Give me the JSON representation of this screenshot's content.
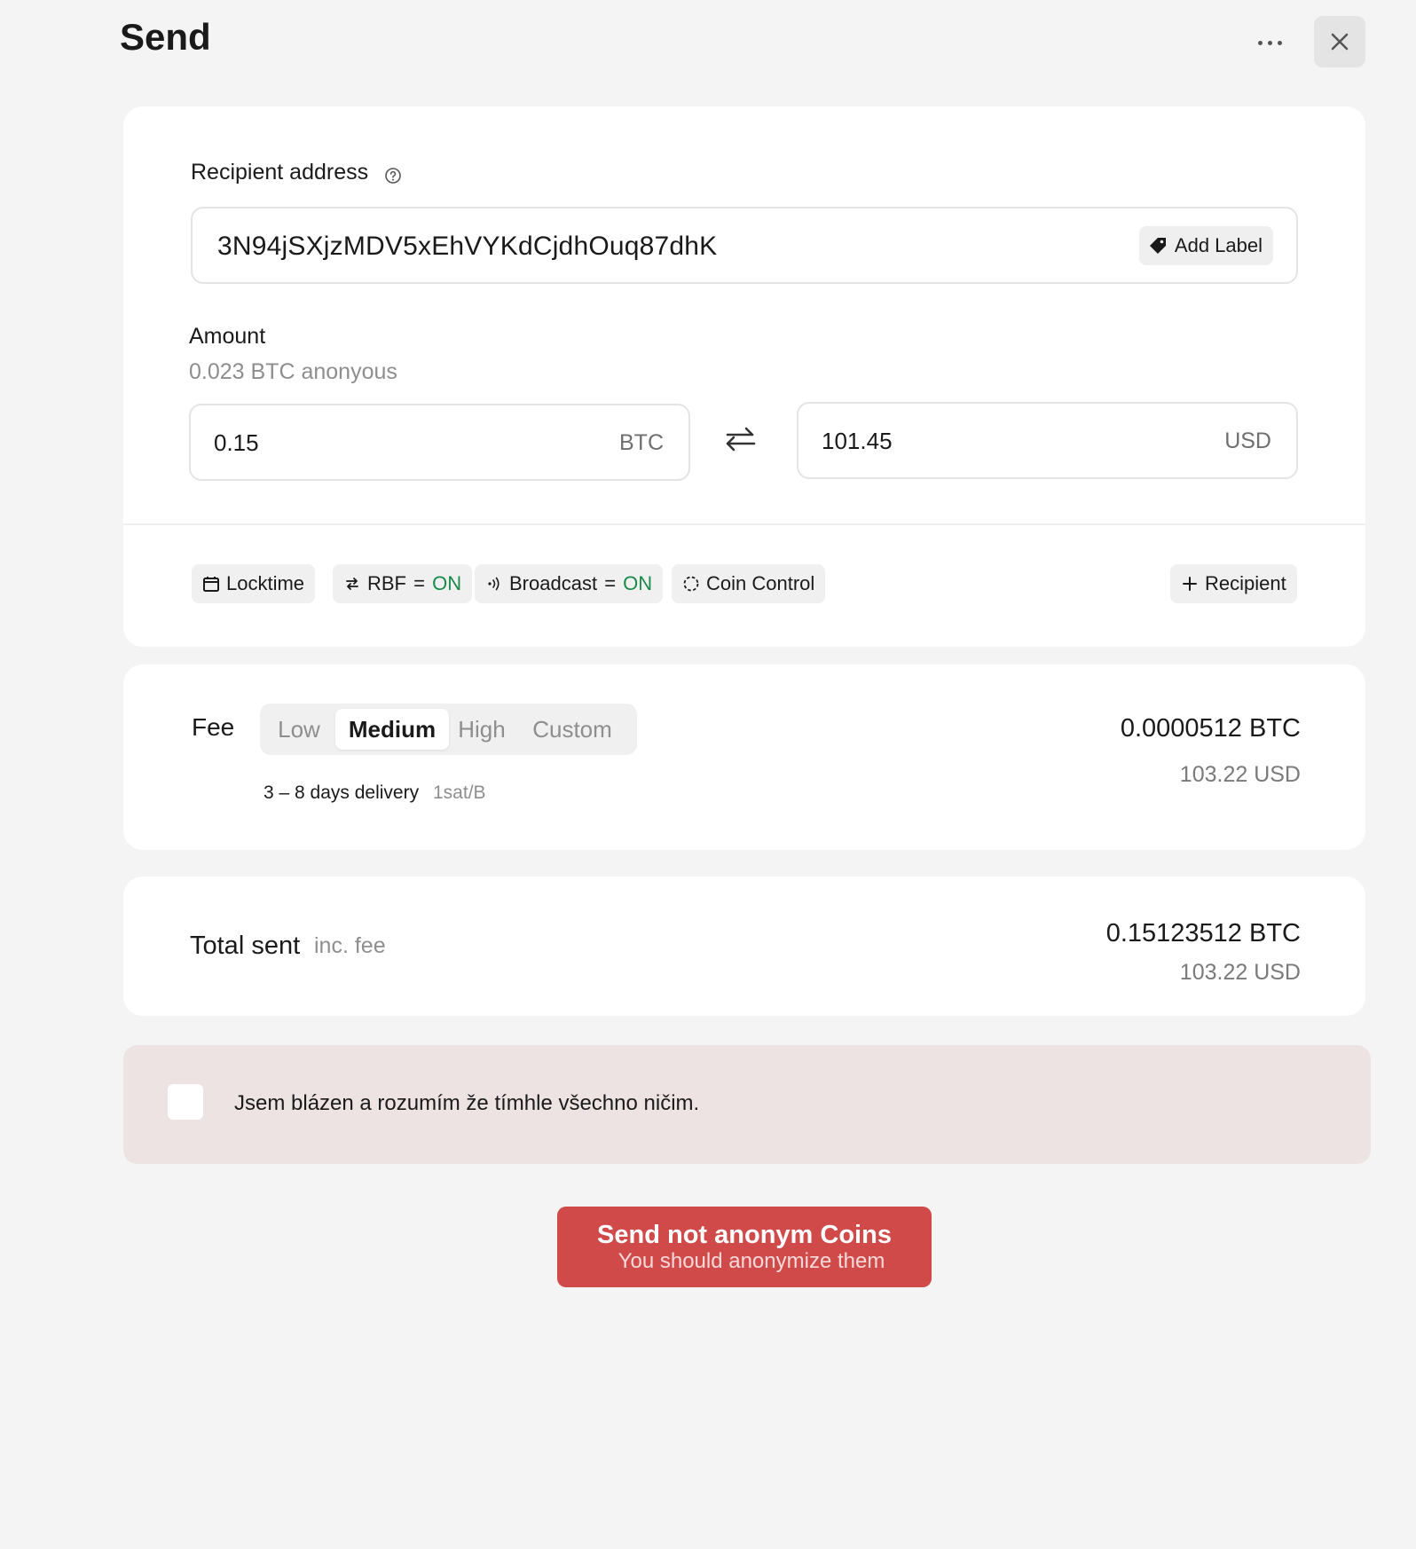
{
  "header": {
    "title": "Send",
    "more_icon": "more-horizontal-icon",
    "close_icon": "close-icon"
  },
  "recipient": {
    "label": "Recipient address",
    "help_icon": "help-circle-icon",
    "address": "3N94jSXjzMDV5xEhVYKdCjdhOuq87dhK",
    "add_label": "Add Label",
    "add_label_icon": "tag-icon"
  },
  "amount": {
    "label": "Amount",
    "available": "0.023 BTC anonyous",
    "btc_value": "0.15",
    "btc_unit": "BTC",
    "usd_value": "101.45",
    "usd_unit": "USD",
    "swap_icon": "swap-arrows-icon"
  },
  "options": {
    "locktime": "Locktime",
    "rbf_label": "RBF",
    "rbf_state": "ON",
    "broadcast_label": "Broadcast",
    "broadcast_state": "ON",
    "equals": "=",
    "coin_control": "Coin Control",
    "add_recipient": "Recipient"
  },
  "fee": {
    "label": "Fee",
    "tabs": [
      "Low",
      "Medium",
      "High",
      "Custom"
    ],
    "selected": "Medium",
    "delivery": "3 – 8 days delivery",
    "rate": "1sat/B",
    "btc": "0.0000512 BTC",
    "usd": "103.22 USD"
  },
  "total": {
    "label": "Total sent",
    "inc": "inc. fee",
    "btc": "0.15123512 BTC",
    "usd": "103.22 USD"
  },
  "confirm": {
    "text": "Jsem blázen a rozumím že tímhle všechno ničim.",
    "checked": false
  },
  "send_button": {
    "main": "Send not anonym Coins",
    "sub": "You should anonymize them"
  },
  "colors": {
    "background": "#f4f4f4",
    "card": "#ffffff",
    "on_state": "#1a8a4a",
    "warning_bg": "#ece3e2",
    "danger": "#d04a4a"
  }
}
